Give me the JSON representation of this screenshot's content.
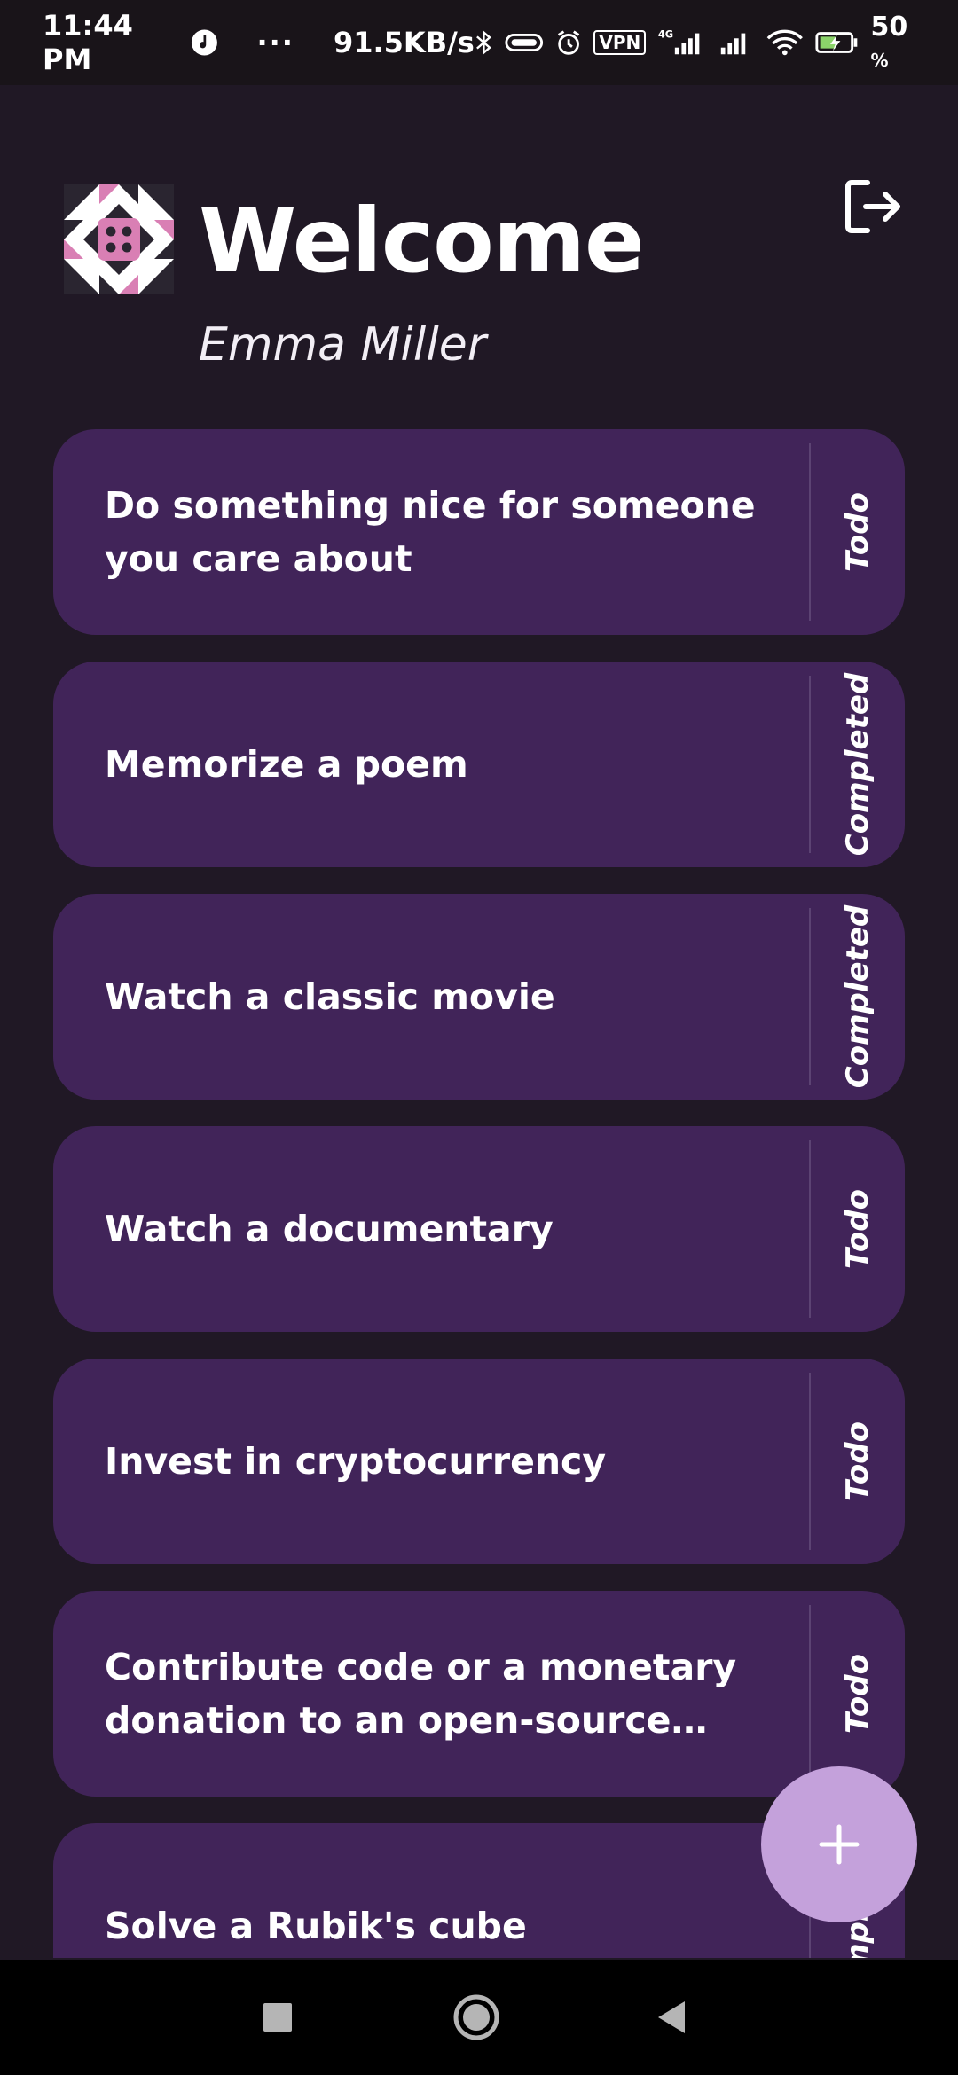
{
  "status_bar": {
    "time": "11:44 PM",
    "dots": "···",
    "speed": "91.5KB/s",
    "vpn": "VPN",
    "network": "4G",
    "battery": "50",
    "battery_unit": "%"
  },
  "header": {
    "welcome": "Welcome",
    "username": "Emma Miller",
    "logo_icon": "dice-quilt-logo-icon",
    "logout_icon": "logout-icon"
  },
  "tasks": [
    {
      "title": "Do something nice for someone you care about",
      "status": "Todo"
    },
    {
      "title": "Memorize a poem",
      "status": "Completed"
    },
    {
      "title": "Watch a classic movie",
      "status": "Completed"
    },
    {
      "title": "Watch a documentary",
      "status": "Todo"
    },
    {
      "title": "Invest in cryptocurrency",
      "status": "Todo"
    },
    {
      "title": "Contribute code or a monetary donation to an open-source software project",
      "status": "Todo"
    },
    {
      "title": "Solve a Rubik's cube",
      "status": "Completed"
    }
  ],
  "fab": {
    "icon": "plus-icon"
  },
  "nav_bar": {
    "icons": [
      "square-recents-icon",
      "circle-home-icon",
      "triangle-back-icon"
    ]
  },
  "colors": {
    "background": "#201825",
    "card": "#412459",
    "fab": "#c4a1db",
    "logo_pink": "#d97fb4"
  }
}
